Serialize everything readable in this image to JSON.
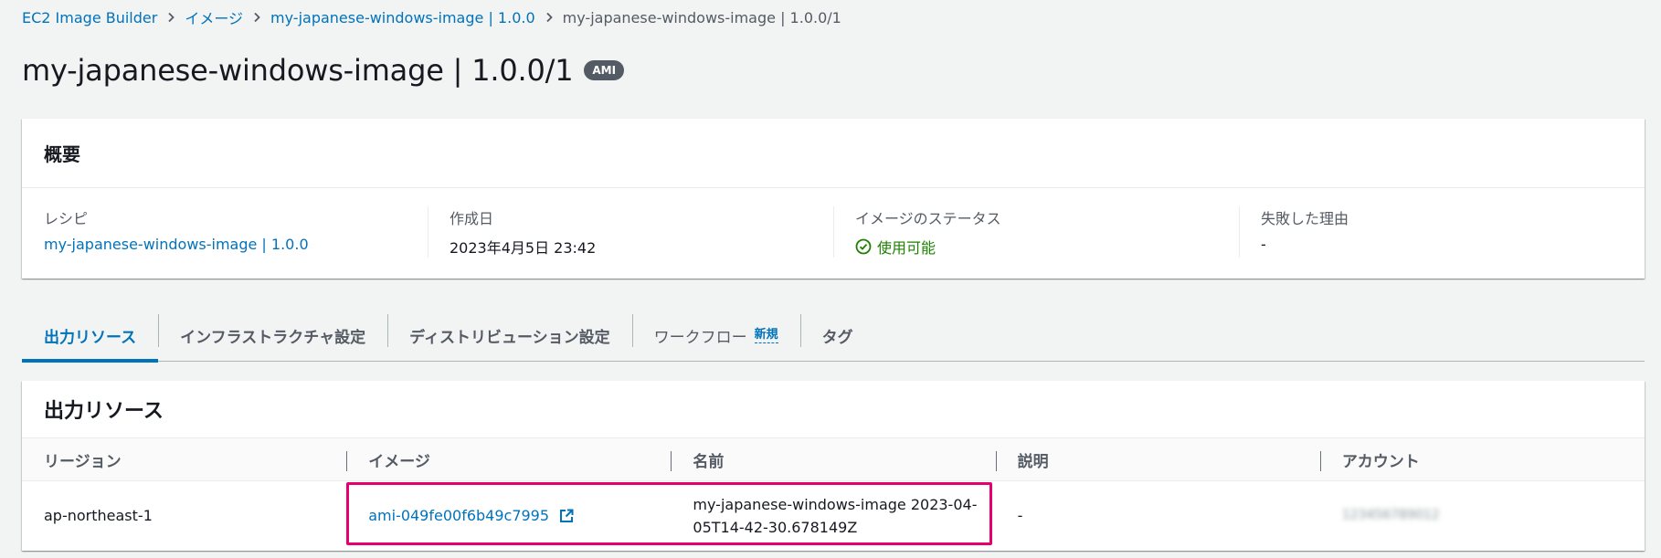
{
  "breadcrumb": {
    "items": [
      "EC2 Image Builder",
      "イメージ",
      "my-japanese-windows-image | 1.0.0"
    ],
    "current": "my-japanese-windows-image | 1.0.0/1"
  },
  "page": {
    "title": "my-japanese-windows-image | 1.0.0/1",
    "badge": "AMI"
  },
  "overview": {
    "heading": "概要",
    "columns": [
      {
        "label": "レシピ",
        "value": "my-japanese-windows-image | 1.0.0"
      },
      {
        "label": "作成日",
        "value": "2023年4月5日 23:42"
      },
      {
        "label": "イメージのステータス",
        "value": "使用可能"
      },
      {
        "label": "失敗した理由",
        "value": "-"
      }
    ]
  },
  "tabs": {
    "items": [
      "出力リソース",
      "インフラストラクチャ設定",
      "ディストリビューション設定",
      "ワークフロー",
      "タグ"
    ],
    "new_badge": "新規",
    "active_index": 0
  },
  "resources": {
    "heading": "出力リソース",
    "columns": [
      "リージョン",
      "イメージ",
      "名前",
      "説明",
      "アカウント"
    ],
    "rows": [
      {
        "region": "ap-northeast-1",
        "image": "ami-049fe00f6b49c7995",
        "name": "my-japanese-windows-image 2023-04-05T14-42-30.678149Z",
        "description": "-",
        "account": "123456789012"
      }
    ]
  },
  "colors": {
    "link": "#0073bb",
    "success": "#1d8102",
    "highlight": "#e6006e",
    "badge_bg": "#545b64"
  },
  "icons": {
    "breadcrumb_separator": "chevron-right-icon",
    "status": "check-circle-icon",
    "external": "external-link-icon"
  }
}
